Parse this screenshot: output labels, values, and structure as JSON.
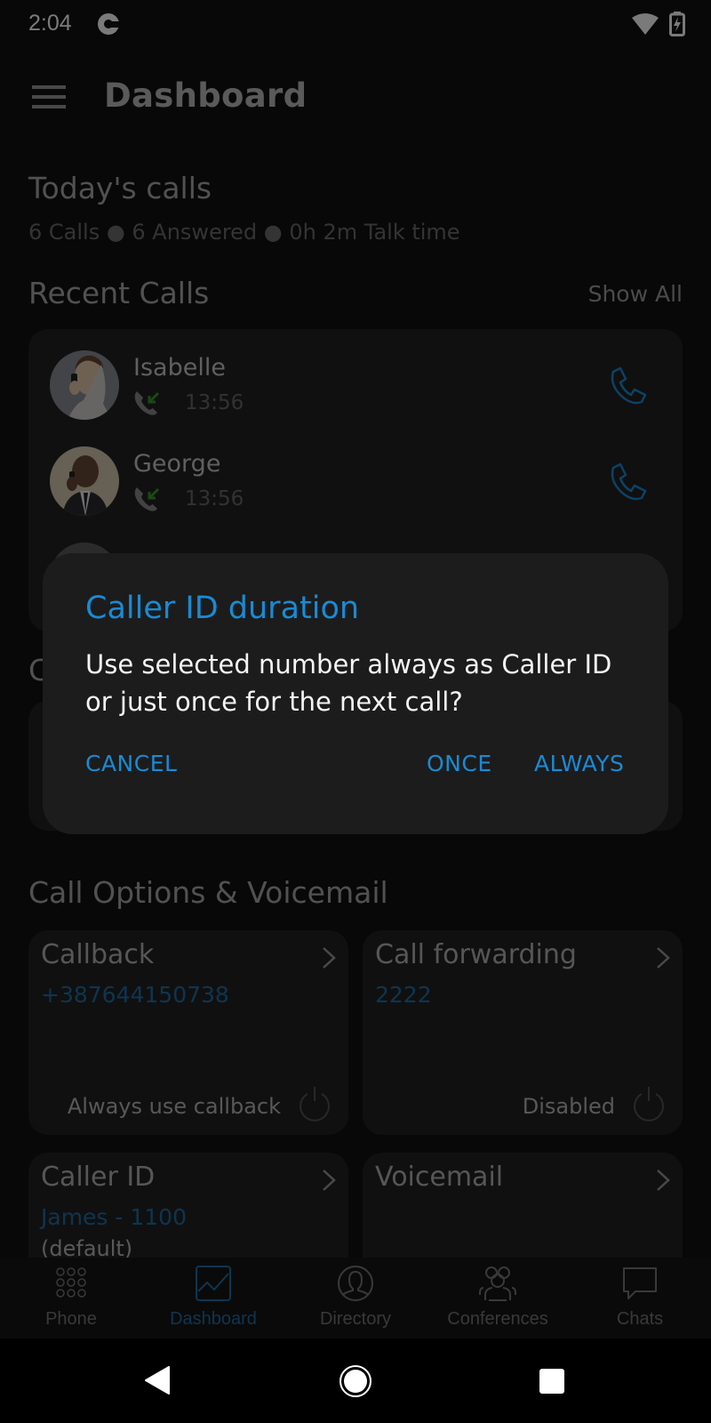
{
  "status_bar": {
    "time": "2:04",
    "icons": [
      "google-icon",
      "wifi-icon",
      "battery-charging-icon"
    ]
  },
  "app_bar": {
    "menu_icon": "hamburger-menu-icon",
    "title": "Dashboard"
  },
  "todays_calls": {
    "title": "Today's calls",
    "summary": "6 Calls ● 6 Answered ● 0h 2m Talk time"
  },
  "recent_calls": {
    "title": "Recent Calls",
    "show_all_label": "Show All",
    "items": [
      {
        "name": "Isabelle",
        "direction": "incoming",
        "time": "13:56",
        "avatar": "photo"
      },
      {
        "name": "George",
        "direction": "incoming",
        "time": "13:56",
        "avatar": "photo"
      }
    ]
  },
  "call_options": {
    "title": "Call Options & Voicemail",
    "cards": [
      {
        "title": "Callback",
        "value": "+387644150738",
        "status_label": "Always use callback",
        "toggle": "off"
      },
      {
        "title": "Call forwarding",
        "value": "2222",
        "status_label": "Disabled",
        "toggle": "off"
      },
      {
        "title": "Caller ID",
        "value": "James - 1100",
        "sub_value": "(default)"
      },
      {
        "title": "Voicemail"
      }
    ]
  },
  "bottom_nav": {
    "items": [
      {
        "label": "Phone",
        "icon": "dialpad-icon",
        "active": false
      },
      {
        "label": "Dashboard",
        "icon": "chart-icon",
        "active": true
      },
      {
        "label": "Directory",
        "icon": "person-icon",
        "active": false
      },
      {
        "label": "Conferences",
        "icon": "group-icon",
        "active": false
      },
      {
        "label": "Chats",
        "icon": "chat-bubble-icon",
        "active": false
      }
    ]
  },
  "dialog": {
    "title": "Caller ID duration",
    "message": "Use selected number always as Caller ID or just once for the next call?",
    "buttons": {
      "cancel": "CANCEL",
      "once": "ONCE",
      "always": "ALWAYS"
    }
  },
  "colors": {
    "accent": "#1a8ad4",
    "incoming_arrow": "#3a9a2a",
    "background": "#111111",
    "dialog_bg": "#1c1c1c"
  }
}
